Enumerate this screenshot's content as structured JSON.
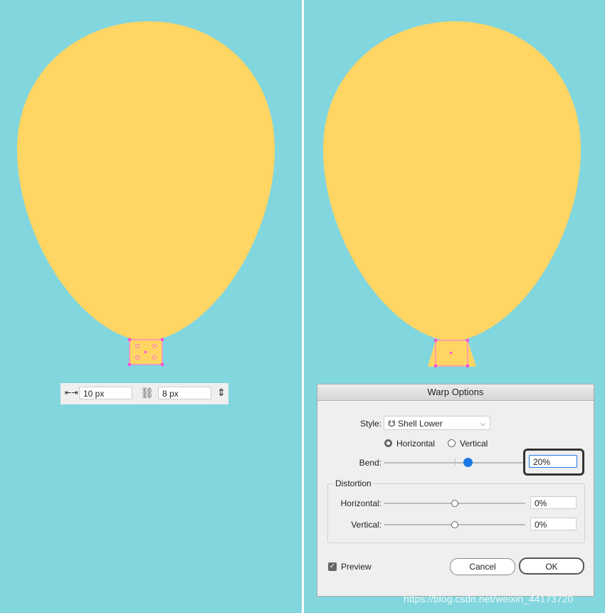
{
  "colors": {
    "background": "#82d6de",
    "balloon": "#ffd563",
    "selection": "#ff4fd8",
    "accent": "#1c7ae6"
  },
  "transform_bar": {
    "width_icon": "width-arrows-icon",
    "width": "10 px",
    "link_icon": "unlinked-chain-icon",
    "height": "8 px",
    "height_icon": "height-arrows-icon"
  },
  "dialog": {
    "title": "Warp Options",
    "style_label": "Style:",
    "style_value": "Shell Lower",
    "style_icon": "shell-lower-icon",
    "orientation": {
      "horizontal": "Horizontal",
      "vertical": "Vertical",
      "selected": "Horizontal"
    },
    "bend_label": "Bend:",
    "bend_value": "20%",
    "bend_percent": 20,
    "distortion_label": "Distortion",
    "dist_horizontal_label": "Horizontal:",
    "dist_horizontal_value": "0%",
    "dist_vertical_label": "Vertical:",
    "dist_vertical_value": "0%",
    "preview_label": "Preview",
    "preview_checked": true,
    "cancel": "Cancel",
    "ok": "OK"
  },
  "watermark": "https://blog.csdn.net/weixin_44173720"
}
